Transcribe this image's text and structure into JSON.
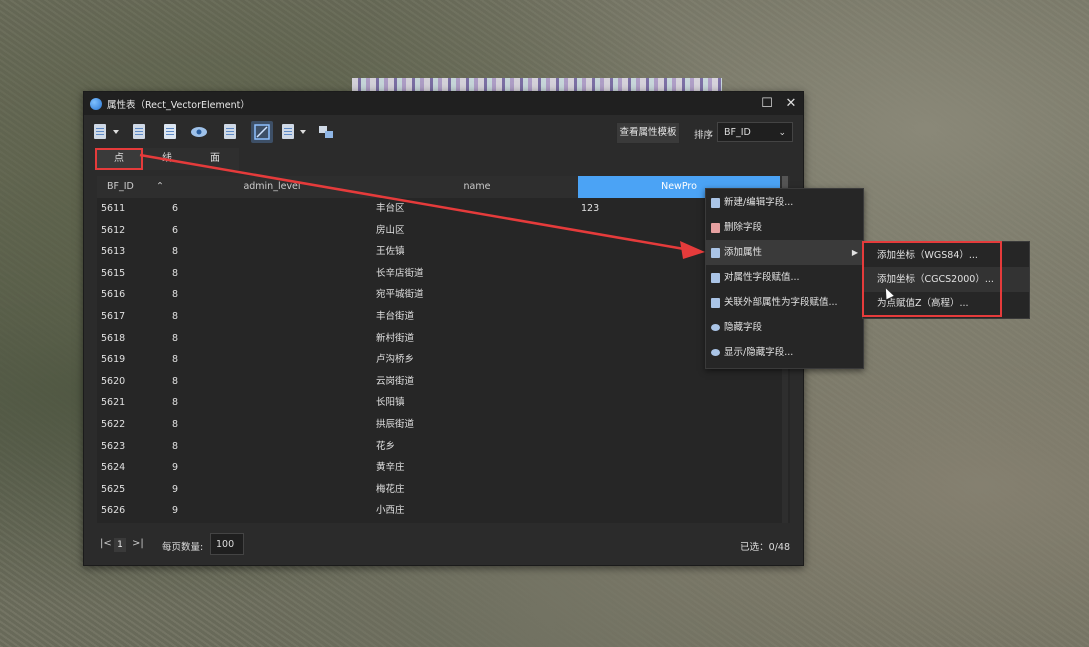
{
  "window": {
    "title": "属性表（Rect_VectorElement）",
    "maximize_glyph": "☐",
    "close_glyph": "✕"
  },
  "toolbar": {
    "template_button": "查看属性模板",
    "sort_label": "排序",
    "sort_value": "BF_ID",
    "sort_chevron": "⌄"
  },
  "tabs": [
    {
      "label": "点",
      "active": true
    },
    {
      "label": "线",
      "active": false
    },
    {
      "label": "面",
      "active": false
    }
  ],
  "table": {
    "headers": {
      "bf_id": "BF_ID",
      "sort_glyph": "⌃",
      "admin_level": "admin_level",
      "name": "name",
      "newpro": "NewPro"
    },
    "rows": [
      {
        "bf_id": "5611",
        "admin_level": "6",
        "name": "丰台区",
        "newpro": "123"
      },
      {
        "bf_id": "5612",
        "admin_level": "6",
        "name": "房山区",
        "newpro": ""
      },
      {
        "bf_id": "5613",
        "admin_level": "8",
        "name": "王佐镇",
        "newpro": ""
      },
      {
        "bf_id": "5615",
        "admin_level": "8",
        "name": "长辛店街道",
        "newpro": ""
      },
      {
        "bf_id": "5616",
        "admin_level": "8",
        "name": "宛平城街道",
        "newpro": ""
      },
      {
        "bf_id": "5617",
        "admin_level": "8",
        "name": "丰台街道",
        "newpro": ""
      },
      {
        "bf_id": "5618",
        "admin_level": "8",
        "name": "新村街道",
        "newpro": ""
      },
      {
        "bf_id": "5619",
        "admin_level": "8",
        "name": "卢沟桥乡",
        "newpro": ""
      },
      {
        "bf_id": "5620",
        "admin_level": "8",
        "name": "云岗街道",
        "newpro": ""
      },
      {
        "bf_id": "5621",
        "admin_level": "8",
        "name": "长阳镇",
        "newpro": ""
      },
      {
        "bf_id": "5622",
        "admin_level": "8",
        "name": "拱辰街道",
        "newpro": ""
      },
      {
        "bf_id": "5623",
        "admin_level": "8",
        "name": "花乡",
        "newpro": ""
      },
      {
        "bf_id": "5624",
        "admin_level": "9",
        "name": "黄辛庄",
        "newpro": ""
      },
      {
        "bf_id": "5625",
        "admin_level": "9",
        "name": "梅花庄",
        "newpro": ""
      },
      {
        "bf_id": "5626",
        "admin_level": "9",
        "name": "小西庄",
        "newpro": ""
      }
    ]
  },
  "footer": {
    "first_glyph": "|<",
    "page": "1",
    "last_glyph": ">|",
    "per_page_label": "每页数量:",
    "per_page_value": "100",
    "selected": "已选：0/48"
  },
  "context_menu": {
    "items": [
      {
        "label": "新建/编辑字段...",
        "icon": "field-edit-icon"
      },
      {
        "label": "删除字段",
        "icon": "field-delete-icon"
      },
      {
        "label": "添加属性",
        "icon": "add-attribute-icon",
        "has_submenu": true,
        "arrow": "▶"
      },
      {
        "label": "对属性字段赋值...",
        "icon": "assign-value-icon"
      },
      {
        "label": "关联外部属性为字段赋值...",
        "icon": "link-external-icon"
      },
      {
        "label": "隐藏字段",
        "icon": "eye-icon"
      },
      {
        "label": "显示/隐藏字段...",
        "icon": "eye-toggle-icon"
      }
    ],
    "submenu": [
      {
        "label": "添加坐标（WGS84）..."
      },
      {
        "label": "添加坐标（CGCS2000）..."
      },
      {
        "label": "为点赋值Z（高程）..."
      }
    ]
  },
  "colors": {
    "accent": "#4ba3f5",
    "highlight_red": "#e53b3b",
    "window_bg": "#2b2b2b"
  }
}
